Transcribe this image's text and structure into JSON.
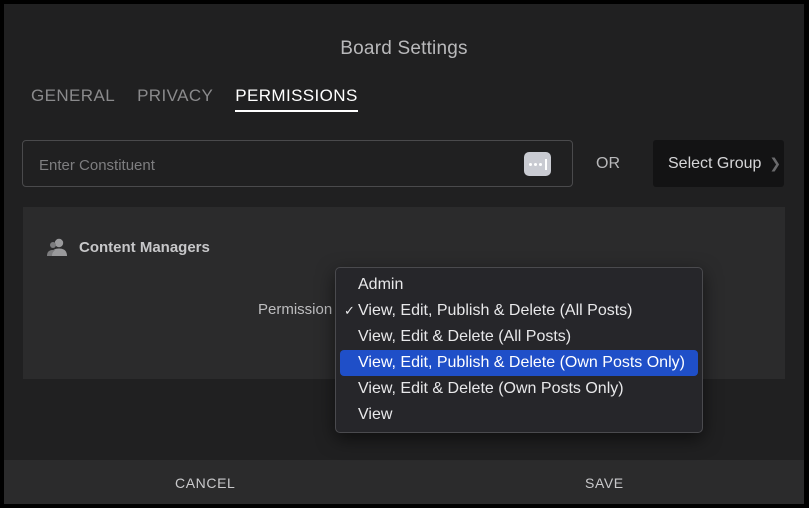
{
  "dialog": {
    "title": "Board Settings"
  },
  "tabs": [
    {
      "label": "GENERAL",
      "active": false
    },
    {
      "label": "PRIVACY",
      "active": false
    },
    {
      "label": "PERMISSIONS",
      "active": true
    }
  ],
  "constituent": {
    "placeholder": "Enter Constituent",
    "value": ""
  },
  "or_label": "OR",
  "select_group": {
    "label": "Select Group"
  },
  "managers": {
    "title": "Content Managers",
    "permission_label": "Permission"
  },
  "permission_menu": {
    "items": [
      {
        "label": "Admin",
        "checked": false,
        "highlighted": false
      },
      {
        "label": "View, Edit, Publish & Delete (All Posts)",
        "checked": true,
        "highlighted": false
      },
      {
        "label": "View, Edit & Delete (All Posts)",
        "checked": false,
        "highlighted": false
      },
      {
        "label": "View, Edit, Publish & Delete (Own Posts Only)",
        "checked": false,
        "highlighted": true
      },
      {
        "label": "View, Edit & Delete (Own Posts Only)",
        "checked": false,
        "highlighted": false
      },
      {
        "label": "View",
        "checked": false,
        "highlighted": false
      }
    ],
    "check_glyph": "✓"
  },
  "footer": {
    "cancel_label": "CANCEL",
    "save_label": "SAVE"
  },
  "colors": {
    "dialog_bg": "#202021",
    "panel_bg": "#2b2b2c",
    "highlight": "#1f4fc8",
    "active_tab": "#ffffff"
  },
  "icons": {
    "more": "more-icon",
    "chevron": "chevron-right-icon",
    "managers": "user-group-icon",
    "check": "check-icon"
  }
}
